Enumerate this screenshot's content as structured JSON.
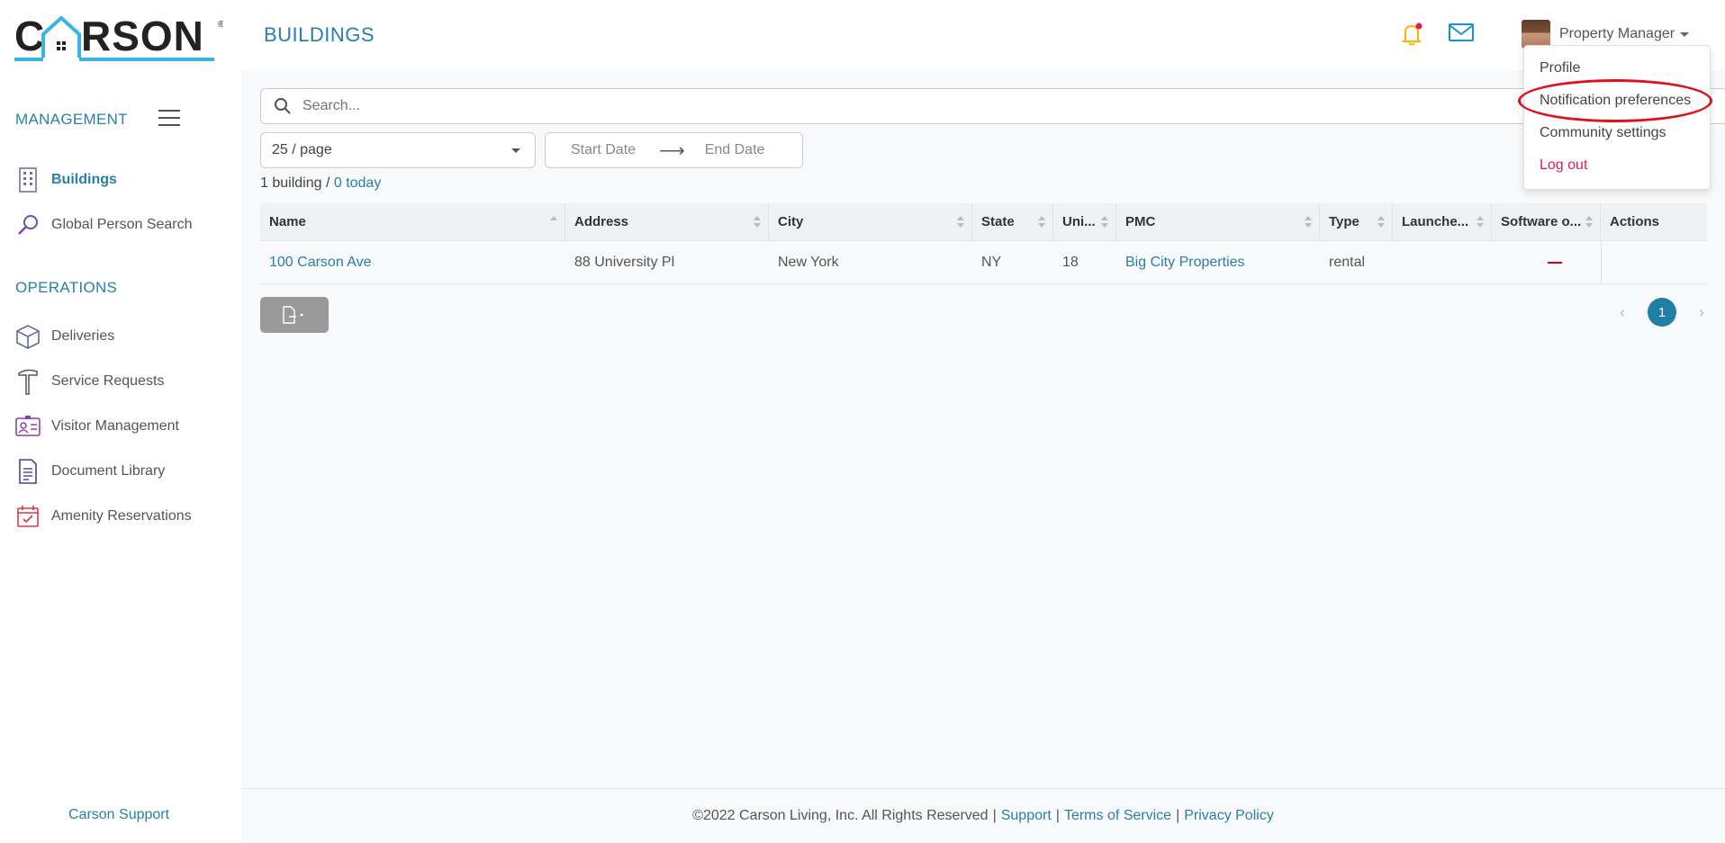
{
  "brand": {
    "logo_text": "CARSON",
    "logo_registered": "®",
    "colors": {
      "primary": "#2a7fa6",
      "text": "#333333",
      "logo_roof": "#3bb4e5",
      "logout": "#e6175c",
      "highlight": "#e0111b"
    }
  },
  "sidebar": {
    "management_label": "MANAGEMENT",
    "operations_label": "OPERATIONS",
    "management_items": [
      {
        "label": "Buildings",
        "icon": "building-icon",
        "active": true
      },
      {
        "label": "Global Person Search",
        "icon": "search-icon",
        "active": false
      }
    ],
    "operations_items": [
      {
        "label": "Deliveries",
        "icon": "package-icon"
      },
      {
        "label": "Service Requests",
        "icon": "hammer-icon"
      },
      {
        "label": "Visitor Management",
        "icon": "id-card-icon"
      },
      {
        "label": "Document Library",
        "icon": "document-icon"
      },
      {
        "label": "Amenity Reservations",
        "icon": "calendar-check-icon"
      }
    ],
    "support_label": "Carson Support"
  },
  "header": {
    "title": "BUILDINGS",
    "user_name": "Property Manager",
    "notification_dot": true
  },
  "user_menu": {
    "items": [
      "Profile",
      "Notification preferences",
      "Community settings",
      "Log out"
    ],
    "highlighted_item": "Notification preferences"
  },
  "filters": {
    "search_placeholder": "Search...",
    "per_page": "25 / page",
    "start_date_placeholder": "Start Date",
    "end_date_placeholder": "End Date",
    "count_text": "1 building / ",
    "today_text": "0 today"
  },
  "table": {
    "columns": [
      "Name",
      "Address",
      "City",
      "State",
      "Uni...",
      "PMC",
      "Type",
      "Launche...",
      "Software o...",
      "Actions"
    ],
    "rows": [
      {
        "name": "100 Carson Ave",
        "address": "88 University Pl",
        "city": "New York",
        "state": "NY",
        "units": "18",
        "pmc": "Big City Properties",
        "type": "rental",
        "launched": "",
        "software": "—",
        "actions": ""
      }
    ]
  },
  "pagination": {
    "current_page": "1",
    "prev": "‹",
    "next": "›"
  },
  "footer": {
    "copyright": "©2022 Carson Living, Inc. All Rights Reserved",
    "links": [
      "Support",
      "Terms of Service",
      "Privacy Policy"
    ],
    "separator": "|"
  }
}
